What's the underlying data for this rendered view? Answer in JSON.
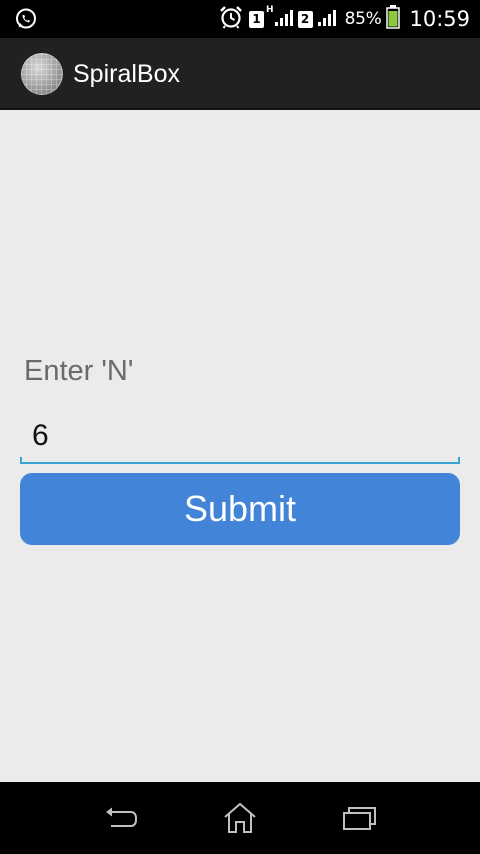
{
  "status_bar": {
    "sim1": "1",
    "network_type": "H",
    "sim2": "2",
    "battery": "85%",
    "time": "10:59",
    "icons": [
      "whatsapp-icon",
      "alarm-icon",
      "signal-icon",
      "battery-icon"
    ]
  },
  "action_bar": {
    "title": "SpiralBox",
    "icon": "app-logo-icon"
  },
  "form": {
    "label": "Enter 'N'",
    "input_value": "6",
    "submit_label": "Submit"
  },
  "nav_bar": {
    "icons": [
      "back-icon",
      "home-icon",
      "recents-icon"
    ]
  },
  "colors": {
    "accent": "#4285d8",
    "input_underline": "#3aa3cf",
    "background": "#ebebeb",
    "action_bar": "#212121"
  }
}
